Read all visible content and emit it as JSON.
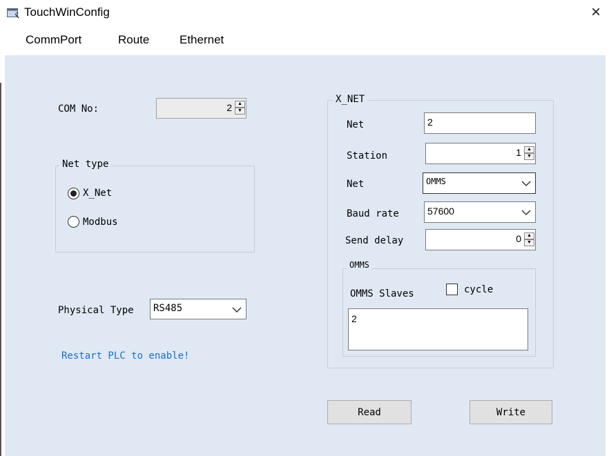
{
  "window": {
    "title": "TouchWinConfig",
    "close_glyph": "×",
    "icon": "app-window-icon"
  },
  "tabs": [
    {
      "label": "CommPort"
    },
    {
      "label": "Route"
    },
    {
      "label": "Ethernet"
    }
  ],
  "left": {
    "com_no_label": "COM No:",
    "com_no_value": "2",
    "net_type_group": "Net type",
    "radio_xnet": "X_Net",
    "radio_modbus": "Modbus",
    "selected_net_type": "X_Net",
    "physical_type_label": "Physical Type",
    "physical_type_value": "RS485",
    "restart_note": "Restart PLC to enable!"
  },
  "xnet": {
    "group_title": "X_NET",
    "net_label": "Net",
    "net_value": "2",
    "station_label": "Station",
    "station_value": "1",
    "net2_label": "Net",
    "net2_value": "OMMS",
    "baud_label": "Baud rate",
    "baud_value": "57600",
    "send_delay_label": "Send delay",
    "send_delay_value": "0",
    "omms_group": "OMMS",
    "omms_slaves_label": "OMMS Slaves",
    "cycle_label": "cycle",
    "cycle_checked": false,
    "slaves_text": "2"
  },
  "buttons": {
    "read": "Read",
    "write": "Write"
  },
  "colors": {
    "client_bg": "#dfe8f3",
    "note_text": "#1a6fcf"
  }
}
